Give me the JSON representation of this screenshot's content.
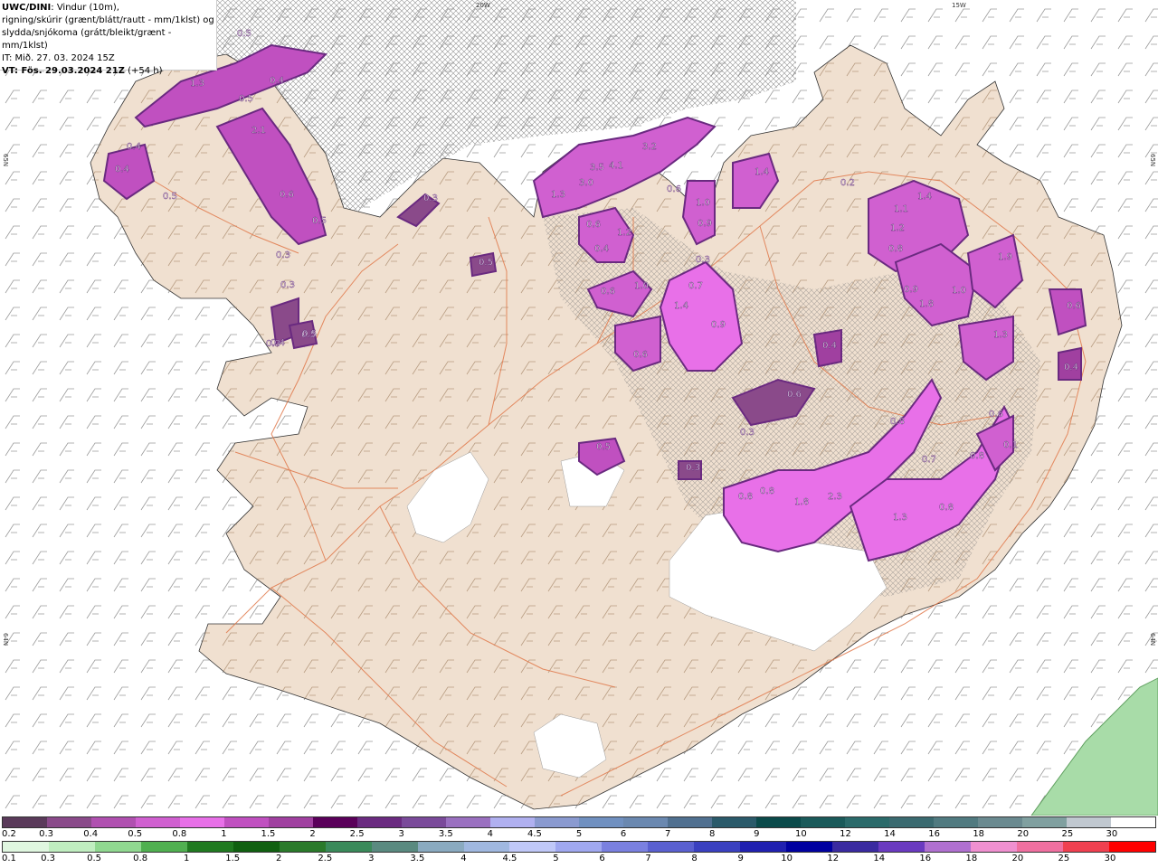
{
  "info": {
    "model": "UWC/DINI",
    "line1_rest": ": Vindur (10m),",
    "line2": "rigning/skúrir (grænt/blátt/rautt - mm/1klst) og",
    "line3": "slydda/snjókoma (grátt/bleikt/grænt - mm/1klst)",
    "it": "IT: Mið. 27. 03. 2024 15Z",
    "vt": "VT: Fös. 29.03.2024 21Z",
    "vt_offset": " (+54 h)"
  },
  "axis_labels": {
    "lon_20w": "20W",
    "lon_15w": "15W",
    "lat_65n_left": "65N",
    "lat_65n_right": "65N",
    "lat_64n_left": "64N",
    "lat_64n_right": "64N"
  },
  "precip_labels": [
    "0.5",
    "1.3",
    "0.4",
    "0.4",
    "2.1",
    "0.5",
    "0.4",
    "0.5",
    "0.6",
    "0.5",
    "0.3",
    "0.3",
    "0.3",
    "0.3",
    "0.5",
    "0.5",
    "3.2",
    "3.5",
    "4.1",
    "3.0",
    "1.3",
    "0.6",
    "1.0",
    "0.6",
    "1.2",
    "0.4",
    "0.9",
    "1.4",
    "0.2",
    "1.4",
    "1.1",
    "1.2",
    "0.8",
    "0.9",
    "1.0",
    "1.8",
    "1.9",
    "0.3",
    "0.7",
    "1.4",
    "0.9",
    "1.0",
    "0.4",
    "1.3",
    "0.6",
    "0.4",
    "0.6",
    "0.6",
    "0.8",
    "0.3",
    "0.8",
    "0.8",
    "1.8",
    "2.3",
    "1.3",
    "0.7",
    "0.8",
    "0.6",
    "0.5",
    "0.3",
    "0.8",
    "0.5",
    "0.4",
    "0.1",
    "0.6"
  ],
  "legend_snow": {
    "ticks": [
      "0.2",
      "0.3",
      "0.4",
      "0.5",
      "0.8",
      "1",
      "1.5",
      "2",
      "2.5",
      "3",
      "3.5",
      "4",
      "4.5",
      "5",
      "6",
      "7",
      "8",
      "9",
      "10",
      "12",
      "14",
      "16",
      "18",
      "20",
      "25",
      "30"
    ],
    "colors": [
      "#5a3a5a",
      "#8a4a8a",
      "#b050b0",
      "#d060d0",
      "#e870e8",
      "#c050c0",
      "#a040a0",
      "#5a005a",
      "#6a2a80",
      "#7a4a9a",
      "#9a70c0",
      "#b0b0f0",
      "#8a9ad0",
      "#7090c0",
      "#6a88b0",
      "#507090",
      "#2a5a6a",
      "#0a4a4a",
      "#1a5a5a",
      "#2a6a6a",
      "#3a6a70",
      "#507a80",
      "#6a8a90",
      "#80a0a0",
      "#c0c8d0",
      "#ffffff"
    ]
  },
  "legend_rain": {
    "ticks": [
      "0.1",
      "0.3",
      "0.5",
      "0.8",
      "1",
      "1.5",
      "2",
      "2.5",
      "3",
      "3.5",
      "4",
      "4.5",
      "5",
      "6",
      "7",
      "8",
      "9",
      "10",
      "12",
      "14",
      "16",
      "18",
      "20",
      "25",
      "30"
    ],
    "colors": [
      "#e0f7e0",
      "#c0eec0",
      "#90d890",
      "#50b050",
      "#207a20",
      "#106010",
      "#2a7a2a",
      "#3a8a5a",
      "#5a8a80",
      "#8aaac0",
      "#a0b8e0",
      "#c0c8f8",
      "#a0a8f0",
      "#7a80e0",
      "#5a60d0",
      "#3a40c0",
      "#2020b0",
      "#0000a0",
      "#3a2aa0",
      "#6a3ac0",
      "#b070d0",
      "#f090d0",
      "#f070a0",
      "#f04050",
      "#ff0000"
    ]
  }
}
